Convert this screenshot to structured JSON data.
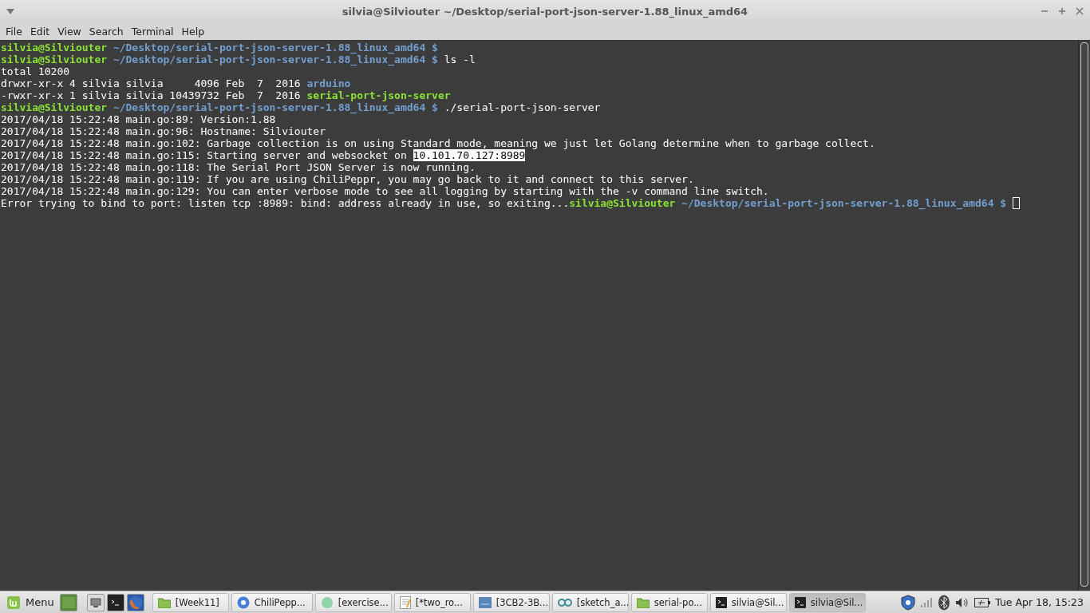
{
  "window": {
    "title": "silvia@Silviouter ~/Desktop/serial-port-json-server-1.88_linux_amd64"
  },
  "menu": [
    "File",
    "Edit",
    "View",
    "Search",
    "Terminal",
    "Help"
  ],
  "terminal": {
    "lines": [
      {
        "segments": [
          {
            "kind": "user",
            "text": "silvia@Silviouter"
          },
          {
            "kind": "path",
            "text": " ~/Desktop/serial-port-json-server-1.88_linux_amd64 $"
          }
        ]
      },
      {
        "segments": [
          {
            "kind": "user",
            "text": "silvia@Silviouter"
          },
          {
            "kind": "path",
            "text": " ~/Desktop/serial-port-json-server-1.88_linux_amd64 $"
          },
          {
            "kind": "text",
            "text": " ls -l"
          }
        ]
      },
      {
        "segments": [
          {
            "kind": "text",
            "text": "total 10200"
          }
        ]
      },
      {
        "segments": [
          {
            "kind": "text",
            "text": "drwxr-xr-x 4 silvia silvia     4096 Feb  7  2016 "
          },
          {
            "kind": "dir",
            "text": "arduino"
          }
        ]
      },
      {
        "segments": [
          {
            "kind": "text",
            "text": "-rwxr-xr-x 1 silvia silvia 10439732 Feb  7  2016 "
          },
          {
            "kind": "exec",
            "text": "serial-port-json-server"
          }
        ]
      },
      {
        "segments": [
          {
            "kind": "user",
            "text": "silvia@Silviouter"
          },
          {
            "kind": "path",
            "text": " ~/Desktop/serial-port-json-server-1.88_linux_amd64 $"
          },
          {
            "kind": "text",
            "text": " ./serial-port-json-server"
          }
        ]
      },
      {
        "segments": [
          {
            "kind": "text",
            "text": "2017/04/18 15:22:48 main.go:89: Version:1.88"
          }
        ]
      },
      {
        "segments": [
          {
            "kind": "text",
            "text": "2017/04/18 15:22:48 main.go:96: Hostname: Silviouter"
          }
        ]
      },
      {
        "segments": [
          {
            "kind": "text",
            "text": "2017/04/18 15:22:48 main.go:102: Garbage collection is on using Standard mode, meaning we just let Golang determine when to garbage collect."
          }
        ]
      },
      {
        "segments": [
          {
            "kind": "text",
            "text": "2017/04/18 15:22:48 main.go:115: Starting server and websocket on "
          },
          {
            "kind": "selected",
            "text": "10.101.70.127:8989"
          }
        ]
      },
      {
        "segments": [
          {
            "kind": "text",
            "text": "2017/04/18 15:22:48 main.go:118: The Serial Port JSON Server is now running."
          }
        ]
      },
      {
        "segments": [
          {
            "kind": "text",
            "text": "2017/04/18 15:22:48 main.go:119: If you are using ChiliPeppr, you may go back to it and connect to this server."
          }
        ]
      },
      {
        "segments": [
          {
            "kind": "text",
            "text": "2017/04/18 15:22:48 main.go:129: You can enter verbose mode to see all logging by starting with the -v command line switch."
          }
        ]
      },
      {
        "segments": [
          {
            "kind": "text",
            "text": "Error trying to bind to port: listen tcp :8989: bind: address already in use, so exiting..."
          },
          {
            "kind": "user",
            "text": "silvia@Silviouter"
          },
          {
            "kind": "path",
            "text": " ~/Desktop/serial-port-json-server-1.88_linux_amd64 $"
          },
          {
            "kind": "cursor"
          }
        ]
      }
    ]
  },
  "taskbar": {
    "menu_label": "Menu",
    "windows": [
      {
        "kind": "folder",
        "label": "[Week11]",
        "selected": false
      },
      {
        "kind": "browser",
        "label": "ChiliPepp...",
        "selected": false
      },
      {
        "kind": "app",
        "label": "[exercise...",
        "selected": false
      },
      {
        "kind": "editor",
        "label": "[*two_ro...",
        "selected": false
      },
      {
        "kind": "image",
        "label": "[3CB2-3B...",
        "selected": false
      },
      {
        "kind": "arduino",
        "label": "[sketch_a...",
        "selected": false
      },
      {
        "kind": "folder",
        "label": "serial-po...",
        "selected": false
      },
      {
        "kind": "terminal",
        "label": "silvia@Sil...",
        "selected": false
      },
      {
        "kind": "terminal",
        "label": "silvia@Sil...",
        "selected": true
      }
    ],
    "clock": "Tue Apr 18, 15:23"
  }
}
